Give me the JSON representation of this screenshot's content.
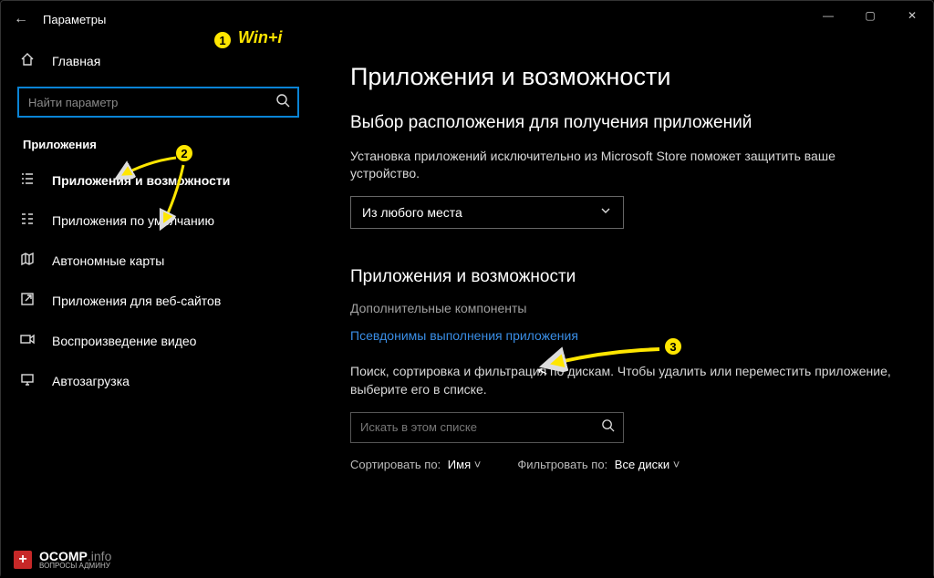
{
  "titlebar": {
    "title": "Параметры"
  },
  "annotations": {
    "shortcut": "Win+i",
    "b1": "1",
    "b2": "2",
    "b3": "3"
  },
  "sidebar": {
    "home": "Главная",
    "search_placeholder": "Найти параметр",
    "section": "Приложения",
    "items": [
      "Приложения и возможности",
      "Приложения по умолчанию",
      "Автономные карты",
      "Приложения для веб-сайтов",
      "Воспроизведение видео",
      "Автозагрузка"
    ]
  },
  "main": {
    "title": "Приложения и возможности",
    "sub1_heading": "Выбор расположения для получения приложений",
    "sub1_text": "Установка приложений исключительно из Microsoft Store поможет защитить ваше устройство.",
    "select_value": "Из любого места",
    "sub2_heading": "Приложения и возможности",
    "opt_components": "Дополнительные компоненты",
    "opt_aliases": "Псевдонимы выполнения приложения",
    "filter_text": "Поиск, сортировка и фильтрация по дискам. Чтобы удалить или переместить приложение, выберите его в списке.",
    "filter_placeholder": "Искать в этом списке",
    "sort_label": "Сортировать по:",
    "sort_value": "Имя",
    "filter_label": "Фильтровать по:",
    "filter_value": "Все диски"
  },
  "watermark": {
    "brand": "OCOMP",
    "suffix": ".info",
    "sub": "ВОПРОСЫ АДМИНУ"
  }
}
